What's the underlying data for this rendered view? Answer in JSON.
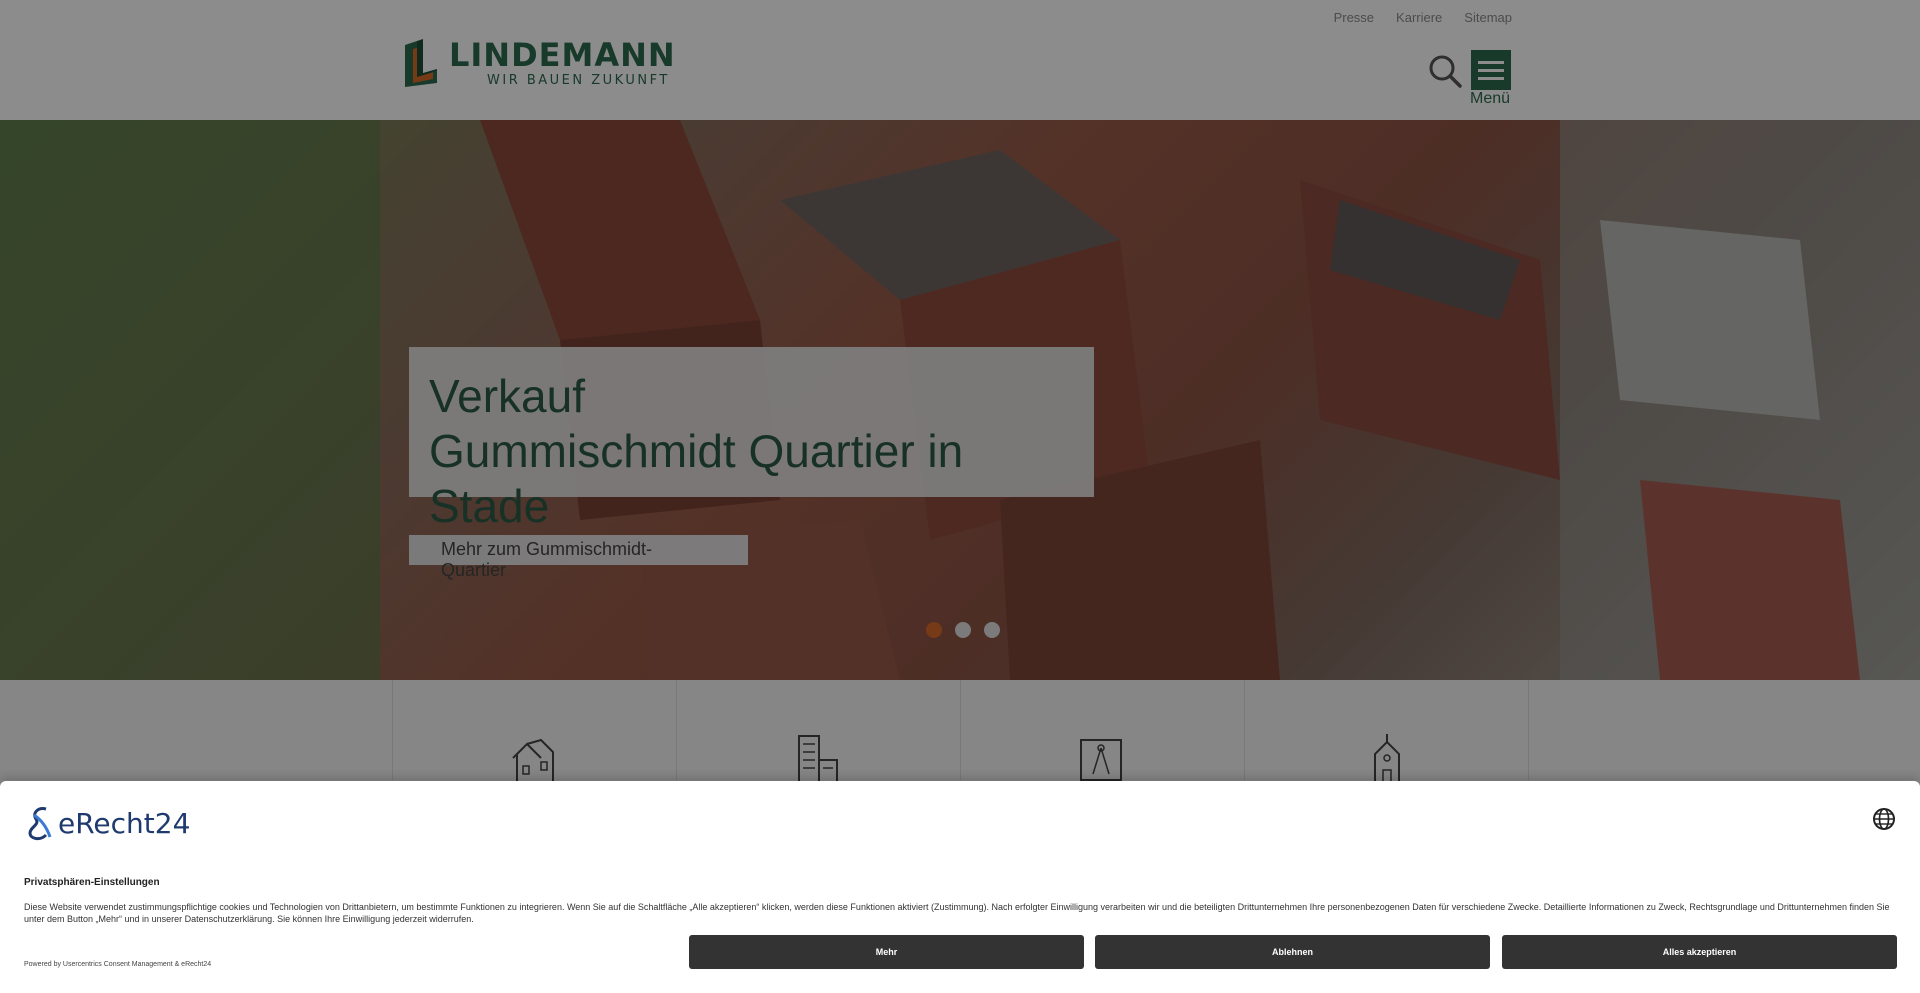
{
  "header": {
    "top_links": [
      "Presse",
      "Karriere",
      "Sitemap"
    ],
    "logo_name": "LINDEMANN",
    "logo_tagline": "WIR BAUEN ZUKUNFT",
    "menu_label": "Menü"
  },
  "hero": {
    "title_line1": "Verkauf",
    "title_line2": "Gummischmidt Quartier in Stade",
    "cta_label": "Mehr zum Gummischmidt-Quartier",
    "slide_count": 3,
    "active_slide": 1
  },
  "features": {
    "icons": [
      "house-icon",
      "office-building-icon",
      "blueprint-icon",
      "church-icon"
    ]
  },
  "consent": {
    "brand": "eRecht24",
    "title": "Privatsphären-Einstellungen",
    "text": "Diese Website verwendet zustimmungspflichtige cookies und Technologien von Drittanbietern, um bestimmte Funktionen zu integrieren. Wenn Sie auf die Schaltfläche „Alle akzeptieren“ klicken, werden diese Funktionen aktiviert (Zustimmung). Nach erfolgter Einwilligung verarbeiten wir und die beteiligten Drittunternehmen Ihre personenbezogenen Daten für verschiedene Zwecke. Detaillierte Informationen zu Zweck, Rechtsgrundlage und Drittunternehmen finden Sie unter dem Button „Mehr“ und in unserer Datenschutzerklärung. Sie können Ihre Einwilligung jederzeit widerrufen.",
    "powered_by": "Powered by Usercentrics Consent Management & eRecht24",
    "buttons": {
      "more": "Mehr",
      "decline": "Ablehnen",
      "accept_all": "Alles akzeptieren"
    }
  },
  "colors": {
    "brand_green": "#2d6a4f",
    "accent_orange": "#d86a2a",
    "button_dark": "#333333"
  }
}
